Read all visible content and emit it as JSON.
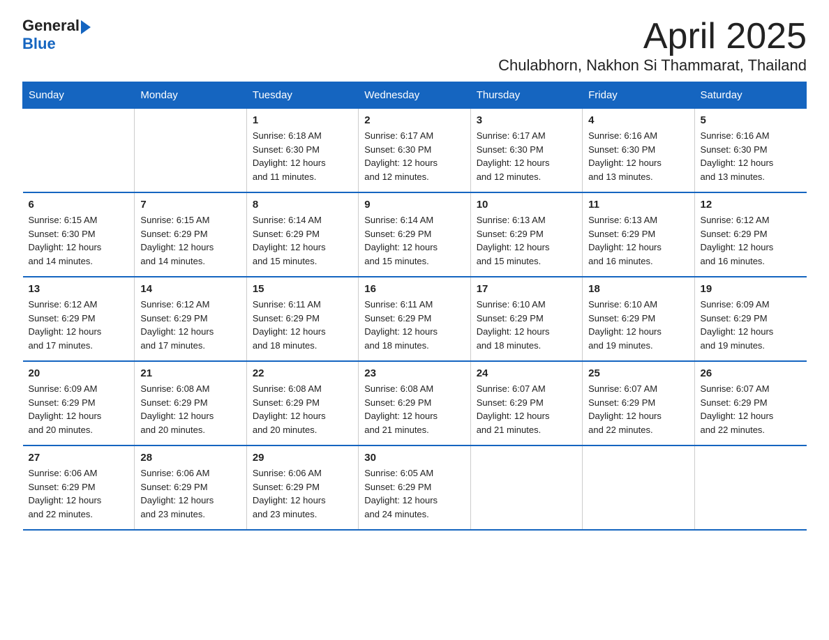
{
  "logo": {
    "text_general": "General",
    "arrow": "▶",
    "text_blue": "Blue"
  },
  "header": {
    "month": "April 2025",
    "location": "Chulabhorn, Nakhon Si Thammarat, Thailand"
  },
  "weekdays": [
    "Sunday",
    "Monday",
    "Tuesday",
    "Wednesday",
    "Thursday",
    "Friday",
    "Saturday"
  ],
  "weeks": [
    [
      {
        "day": "",
        "info": ""
      },
      {
        "day": "",
        "info": ""
      },
      {
        "day": "1",
        "info": "Sunrise: 6:18 AM\nSunset: 6:30 PM\nDaylight: 12 hours\nand 11 minutes."
      },
      {
        "day": "2",
        "info": "Sunrise: 6:17 AM\nSunset: 6:30 PM\nDaylight: 12 hours\nand 12 minutes."
      },
      {
        "day": "3",
        "info": "Sunrise: 6:17 AM\nSunset: 6:30 PM\nDaylight: 12 hours\nand 12 minutes."
      },
      {
        "day": "4",
        "info": "Sunrise: 6:16 AM\nSunset: 6:30 PM\nDaylight: 12 hours\nand 13 minutes."
      },
      {
        "day": "5",
        "info": "Sunrise: 6:16 AM\nSunset: 6:30 PM\nDaylight: 12 hours\nand 13 minutes."
      }
    ],
    [
      {
        "day": "6",
        "info": "Sunrise: 6:15 AM\nSunset: 6:30 PM\nDaylight: 12 hours\nand 14 minutes."
      },
      {
        "day": "7",
        "info": "Sunrise: 6:15 AM\nSunset: 6:29 PM\nDaylight: 12 hours\nand 14 minutes."
      },
      {
        "day": "8",
        "info": "Sunrise: 6:14 AM\nSunset: 6:29 PM\nDaylight: 12 hours\nand 15 minutes."
      },
      {
        "day": "9",
        "info": "Sunrise: 6:14 AM\nSunset: 6:29 PM\nDaylight: 12 hours\nand 15 minutes."
      },
      {
        "day": "10",
        "info": "Sunrise: 6:13 AM\nSunset: 6:29 PM\nDaylight: 12 hours\nand 15 minutes."
      },
      {
        "day": "11",
        "info": "Sunrise: 6:13 AM\nSunset: 6:29 PM\nDaylight: 12 hours\nand 16 minutes."
      },
      {
        "day": "12",
        "info": "Sunrise: 6:12 AM\nSunset: 6:29 PM\nDaylight: 12 hours\nand 16 minutes."
      }
    ],
    [
      {
        "day": "13",
        "info": "Sunrise: 6:12 AM\nSunset: 6:29 PM\nDaylight: 12 hours\nand 17 minutes."
      },
      {
        "day": "14",
        "info": "Sunrise: 6:12 AM\nSunset: 6:29 PM\nDaylight: 12 hours\nand 17 minutes."
      },
      {
        "day": "15",
        "info": "Sunrise: 6:11 AM\nSunset: 6:29 PM\nDaylight: 12 hours\nand 18 minutes."
      },
      {
        "day": "16",
        "info": "Sunrise: 6:11 AM\nSunset: 6:29 PM\nDaylight: 12 hours\nand 18 minutes."
      },
      {
        "day": "17",
        "info": "Sunrise: 6:10 AM\nSunset: 6:29 PM\nDaylight: 12 hours\nand 18 minutes."
      },
      {
        "day": "18",
        "info": "Sunrise: 6:10 AM\nSunset: 6:29 PM\nDaylight: 12 hours\nand 19 minutes."
      },
      {
        "day": "19",
        "info": "Sunrise: 6:09 AM\nSunset: 6:29 PM\nDaylight: 12 hours\nand 19 minutes."
      }
    ],
    [
      {
        "day": "20",
        "info": "Sunrise: 6:09 AM\nSunset: 6:29 PM\nDaylight: 12 hours\nand 20 minutes."
      },
      {
        "day": "21",
        "info": "Sunrise: 6:08 AM\nSunset: 6:29 PM\nDaylight: 12 hours\nand 20 minutes."
      },
      {
        "day": "22",
        "info": "Sunrise: 6:08 AM\nSunset: 6:29 PM\nDaylight: 12 hours\nand 20 minutes."
      },
      {
        "day": "23",
        "info": "Sunrise: 6:08 AM\nSunset: 6:29 PM\nDaylight: 12 hours\nand 21 minutes."
      },
      {
        "day": "24",
        "info": "Sunrise: 6:07 AM\nSunset: 6:29 PM\nDaylight: 12 hours\nand 21 minutes."
      },
      {
        "day": "25",
        "info": "Sunrise: 6:07 AM\nSunset: 6:29 PM\nDaylight: 12 hours\nand 22 minutes."
      },
      {
        "day": "26",
        "info": "Sunrise: 6:07 AM\nSunset: 6:29 PM\nDaylight: 12 hours\nand 22 minutes."
      }
    ],
    [
      {
        "day": "27",
        "info": "Sunrise: 6:06 AM\nSunset: 6:29 PM\nDaylight: 12 hours\nand 22 minutes."
      },
      {
        "day": "28",
        "info": "Sunrise: 6:06 AM\nSunset: 6:29 PM\nDaylight: 12 hours\nand 23 minutes."
      },
      {
        "day": "29",
        "info": "Sunrise: 6:06 AM\nSunset: 6:29 PM\nDaylight: 12 hours\nand 23 minutes."
      },
      {
        "day": "30",
        "info": "Sunrise: 6:05 AM\nSunset: 6:29 PM\nDaylight: 12 hours\nand 24 minutes."
      },
      {
        "day": "",
        "info": ""
      },
      {
        "day": "",
        "info": ""
      },
      {
        "day": "",
        "info": ""
      }
    ]
  ],
  "colors": {
    "header_bg": "#1a6fad",
    "header_text": "#ffffff",
    "border": "#1a6fad"
  }
}
